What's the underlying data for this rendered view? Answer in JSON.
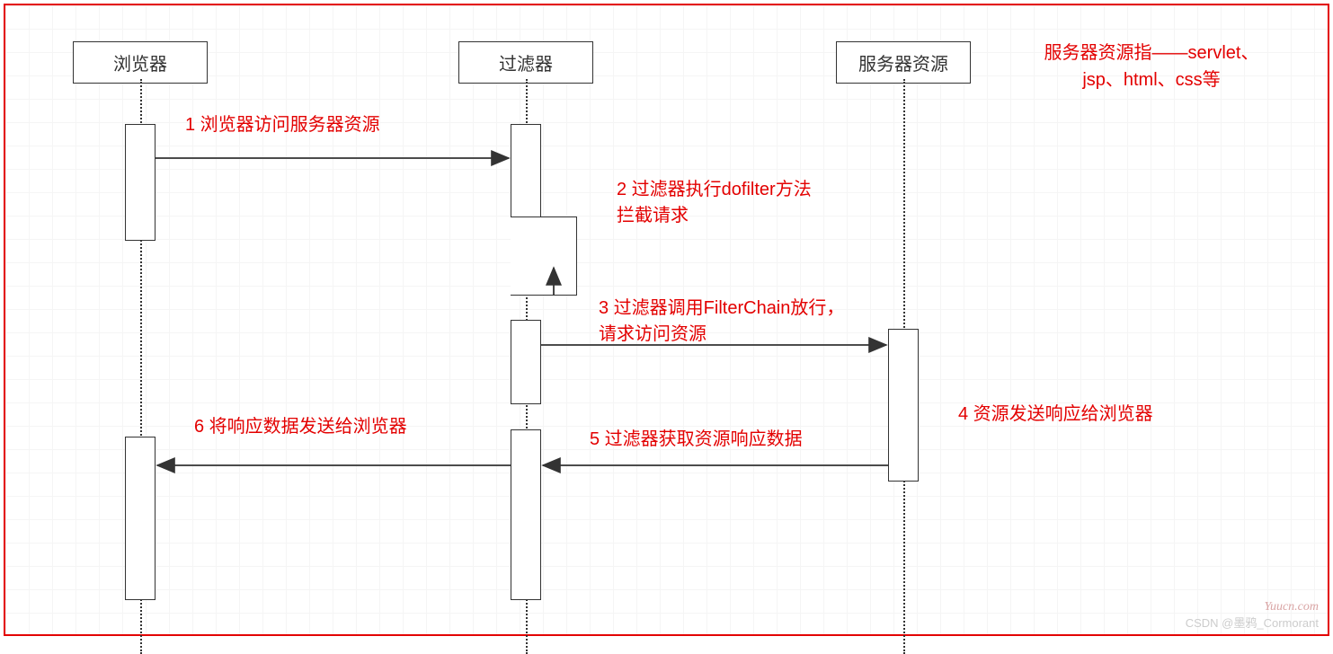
{
  "participants": {
    "browser": "浏览器",
    "filter": "过滤器",
    "resource": "服务器资源"
  },
  "note": {
    "line1": "服务器资源指——servlet、",
    "line2": "jsp、html、css等"
  },
  "messages": {
    "m1": "1 浏览器访问服务器资源",
    "m2_line1": "2 过滤器执行dofilter方法",
    "m2_line2": "拦截请求",
    "m3_line1": "3 过滤器调用FilterChain放行，",
    "m3_line2": "请求访问资源",
    "m4": "4 资源发送响应给浏览器",
    "m5": "5 过滤器获取资源响应数据",
    "m6": "6 将响应数据发送给浏览器"
  },
  "watermarks": {
    "site": "Yuucn.com",
    "csdn": "CSDN @墨鸦_Cormorant"
  },
  "chart_data": {
    "type": "sequence-diagram",
    "participants": [
      "浏览器",
      "过滤器",
      "服务器资源"
    ],
    "note": "服务器资源指——servlet、jsp、html、css等",
    "messages": [
      {
        "seq": 1,
        "from": "浏览器",
        "to": "过滤器",
        "text": "浏览器访问服务器资源"
      },
      {
        "seq": 2,
        "from": "过滤器",
        "to": "过滤器",
        "text": "过滤器执行dofilter方法 拦截请求",
        "self": true
      },
      {
        "seq": 3,
        "from": "过滤器",
        "to": "服务器资源",
        "text": "过滤器调用FilterChain放行，请求访问资源"
      },
      {
        "seq": 4,
        "from": "服务器资源",
        "to": "过滤器",
        "text": "资源发送响应给浏览器",
        "note_position": "right"
      },
      {
        "seq": 5,
        "from": "过滤器",
        "to": "浏览器",
        "text": "过滤器获取资源响应数据",
        "note_position": "above-arrow"
      },
      {
        "seq": 6,
        "from": "浏览器",
        "to": null,
        "text": "将响应数据发送给浏览器",
        "implied": true
      }
    ]
  }
}
